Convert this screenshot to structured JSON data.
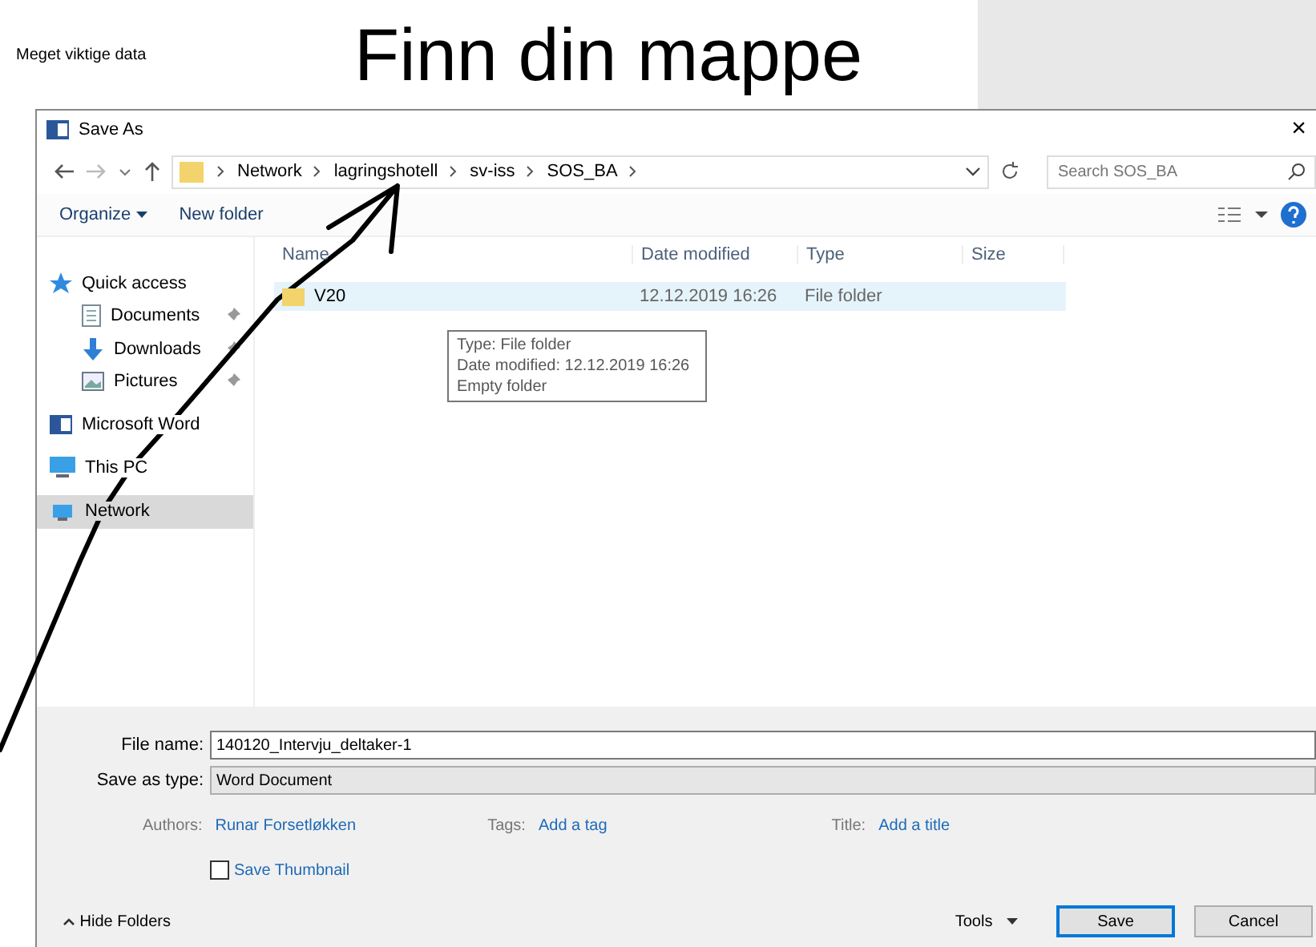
{
  "document": {
    "text": "Meget viktige data"
  },
  "heading": "Finn din mappe",
  "dialog": {
    "title": "Save As",
    "close": "×",
    "breadcrumb": [
      "Network",
      "lagringshotell",
      "sv-iss",
      "SOS_BA"
    ],
    "search": {
      "placeholder": "Search SOS_BA"
    },
    "toolbar": {
      "organize": "Organize",
      "new_folder": "New folder"
    },
    "sidebar": [
      {
        "label": "Quick access",
        "kind": "star",
        "selected": false,
        "children": [
          {
            "label": "Documents",
            "kind": "document",
            "pinned": true,
            "selected": false
          },
          {
            "label": "Downloads",
            "kind": "download",
            "pinned": true,
            "selected": false
          },
          {
            "label": "Pictures",
            "kind": "picture",
            "pinned": true,
            "selected": false
          }
        ]
      },
      {
        "label": "Microsoft Word",
        "kind": "word",
        "selected": false
      },
      {
        "label": "This PC",
        "kind": "pc",
        "selected": false
      },
      {
        "label": "Network",
        "kind": "network",
        "selected": true
      }
    ],
    "columns": [
      "Name",
      "Date modified",
      "Type",
      "Size"
    ],
    "rows": [
      {
        "name": "V20",
        "date": "12.12.2019 16:26",
        "type": "File folder",
        "selected": true
      }
    ],
    "tooltip": [
      "Type: File folder",
      "Date modified: 12.12.2019 16:26",
      "Empty folder"
    ],
    "file_name": {
      "label": "File name:",
      "value": "140120_Intervju_deltaker-1"
    },
    "save_type": {
      "label": "Save as type:",
      "value": "Word Document"
    },
    "meta": [
      {
        "label": "Authors:",
        "value": "Runar Forsetløkken"
      },
      {
        "label": "Tags:",
        "value": "Add a tag"
      },
      {
        "label": "Title:",
        "value": "Add a title"
      }
    ],
    "thumbnail": {
      "label": "Save Thumbnail",
      "checked": false
    },
    "hide_folders": "Hide Folders",
    "tools": "Tools",
    "buttons": [
      "Save",
      "Cancel"
    ]
  }
}
